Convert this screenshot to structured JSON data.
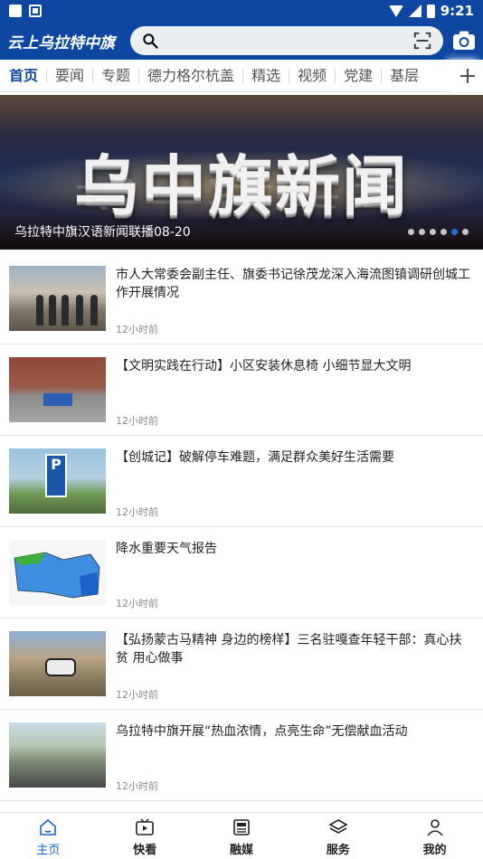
{
  "status_bar": {
    "time": "9:21"
  },
  "header": {
    "logo": "云上乌拉特中旗",
    "search_placeholder": ""
  },
  "tabs": [
    "首页",
    "要闻",
    "专题",
    "德力格尔杭盖",
    "精选",
    "视频",
    "党建",
    "基层"
  ],
  "banner": {
    "headline": "乌中旗新闻",
    "caption": "乌拉特中旗汉语新闻联播08-20",
    "dots": 6,
    "active_dot": 4
  },
  "news": [
    {
      "title": "市人大常委会副主任、旗委书记徐茂龙深入海流图镇调研创城工作开展情况",
      "time": "12小时前"
    },
    {
      "title": "【文明实践在行动】小区安装休息椅  小细节显大文明",
      "time": "12小时前"
    },
    {
      "title": "【创城记】破解停车难题，满足群众美好生活需要",
      "time": "12小时前"
    },
    {
      "title": "降水重要天气报告",
      "time": "12小时前"
    },
    {
      "title": "【弘扬蒙古马精神  身边的榜样】三名驻嘎查年轻干部：真心扶贫  用心做事",
      "time": "12小时前"
    },
    {
      "title": "乌拉特中旗开展“热血浓情，点亮生命”无偿献血活动",
      "time": "12小时前"
    }
  ],
  "thumb3_sign": "P",
  "bottom_nav": [
    {
      "label": "主页",
      "icon": "home-icon",
      "active": true
    },
    {
      "label": "快看",
      "icon": "video-icon",
      "active": false
    },
    {
      "label": "融媒",
      "icon": "newspaper-icon",
      "active": false
    },
    {
      "label": "服务",
      "icon": "layers-icon",
      "active": false
    },
    {
      "label": "我的",
      "icon": "person-icon",
      "active": false
    }
  ],
  "colors": {
    "brand": "#0d47a1",
    "active_nav": "#1565c0",
    "active_dot": "#1e6fd9"
  }
}
